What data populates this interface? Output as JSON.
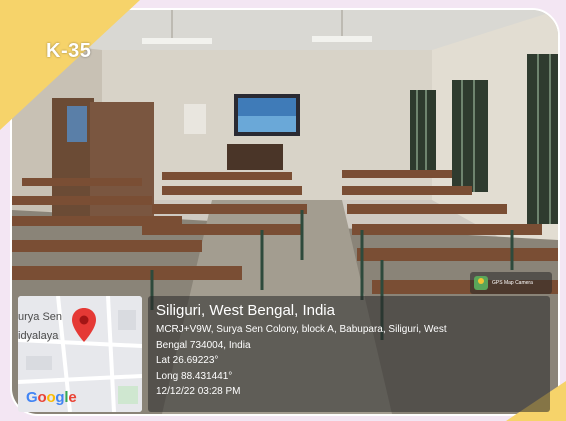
{
  "room_label": "K-35",
  "badge": {
    "text": "GPS Map Camera",
    "icon": "gps-map-camera-icon"
  },
  "map": {
    "place_line1": "urya Sen",
    "place_line2": "idyalaya",
    "logo": "Google",
    "pin_icon": "map-pin-icon",
    "pin_color": "#e53935"
  },
  "location": {
    "city": "Siliguri, West Bengal, India",
    "address_line1": "MCRJ+V9W, Surya Sen Colony, block A, Babupara, Siliguri, West",
    "address_line2": "Bengal 734004, India",
    "lat": "Lat 26.69223°",
    "long": "Long 88.431441°",
    "datetime": "12/12/22 03:28 PM"
  },
  "colors": {
    "accent": "#f6d36a",
    "background": "#f3e6f3"
  }
}
